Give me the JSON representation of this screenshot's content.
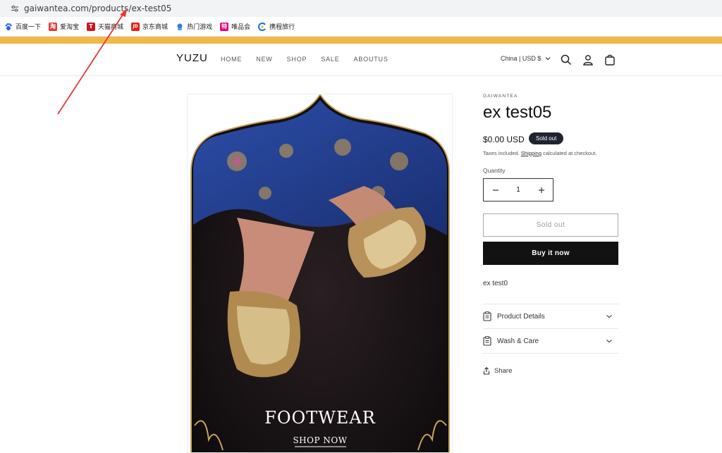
{
  "browser": {
    "url": "gaiwantea.com/products/ex-test05",
    "bookmarks": [
      {
        "label": "百度一下",
        "icon": "baidu-paw-icon",
        "color": "#2e5ee8"
      },
      {
        "label": "爱淘宝",
        "icon": "aitaobao-icon",
        "color": "#e4393c"
      },
      {
        "label": "天猫商城",
        "icon": "tmall-icon",
        "color": "#c81623"
      },
      {
        "label": "京东商城",
        "icon": "jd-icon",
        "color": "#e1251b"
      },
      {
        "label": "热门游戏",
        "icon": "game-icon",
        "color": "#3a7bd5"
      },
      {
        "label": "唯品会",
        "icon": "vip-icon",
        "color": "#e4007f"
      },
      {
        "label": "携程旅行",
        "icon": "ctrip-icon",
        "color": "#2577e3"
      }
    ],
    "bookmark_glyphs": [
      "",
      "淘",
      "T",
      "JD",
      "",
      "特",
      ""
    ]
  },
  "colors": {
    "announcement_bar": "#f0b94a",
    "annotation_arrow": "#e53935",
    "button_dark": "#121212",
    "badge": "#1f2430"
  },
  "store": {
    "logo": "YUZU",
    "nav": [
      "HOME",
      "NEW",
      "SHOP",
      "SALE",
      "ABOUTUS"
    ],
    "locale": "China | USD $",
    "icons": [
      "search-icon",
      "account-icon",
      "cart-icon"
    ]
  },
  "product": {
    "vendor": "GAIWANTEA",
    "title": "ex test05",
    "price": "$0.00 USD",
    "badge": "Sold out",
    "tax_prefix": "Taxes included.",
    "tax_link": "Shipping",
    "tax_suffix": "calculated at checkout.",
    "quantity_label": "Quantity",
    "quantity_value": "1",
    "sold_out_button": "Sold out",
    "buy_button": "Buy it now",
    "description": "ex test0",
    "accordions": [
      {
        "label": "Product Details",
        "icon": "clipboard-icon"
      },
      {
        "label": "Wash & Care",
        "icon": "clipboard-icon"
      }
    ],
    "share": "Share",
    "image": {
      "headline": "FOOTWEAR",
      "cta": "SHOP NOW"
    }
  }
}
